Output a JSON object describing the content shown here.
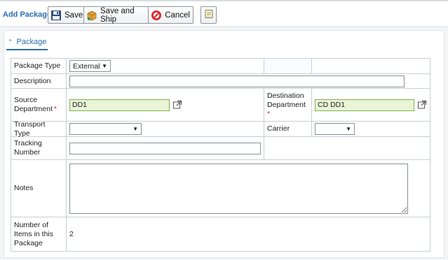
{
  "header": {
    "title": "Add Package",
    "save_label": "Save",
    "save_ship_label": "Save and Ship",
    "cancel_label": "Cancel"
  },
  "section": {
    "title": "Package"
  },
  "form": {
    "package_type": {
      "label": "Package Type",
      "value": "External"
    },
    "description": {
      "label": "Description",
      "value": ""
    },
    "source_department": {
      "label": "Source Department",
      "value": "DD1"
    },
    "destination_department": {
      "label": "Destination Department",
      "value": "CD DD1"
    },
    "transport_type": {
      "label": "Transport Type",
      "value": ""
    },
    "carrier": {
      "label": "Carrier",
      "value": ""
    },
    "tracking_number": {
      "label": "Tracking Number",
      "value": ""
    },
    "notes": {
      "label": "Notes",
      "value": ""
    },
    "item_count": {
      "label": "Number of Items in this Package",
      "value": "2"
    }
  },
  "colors": {
    "accent": "#2a6cb3",
    "required": "#dd2222",
    "field_highlight": "#e9f5d6"
  },
  "icons": {
    "save": "floppy-disk-icon",
    "save_ship": "package-ship-icon",
    "cancel": "cancel-icon",
    "notes": "notepad-icon",
    "external_link": "external-link-icon",
    "collapse": "chevron-up-icon"
  }
}
